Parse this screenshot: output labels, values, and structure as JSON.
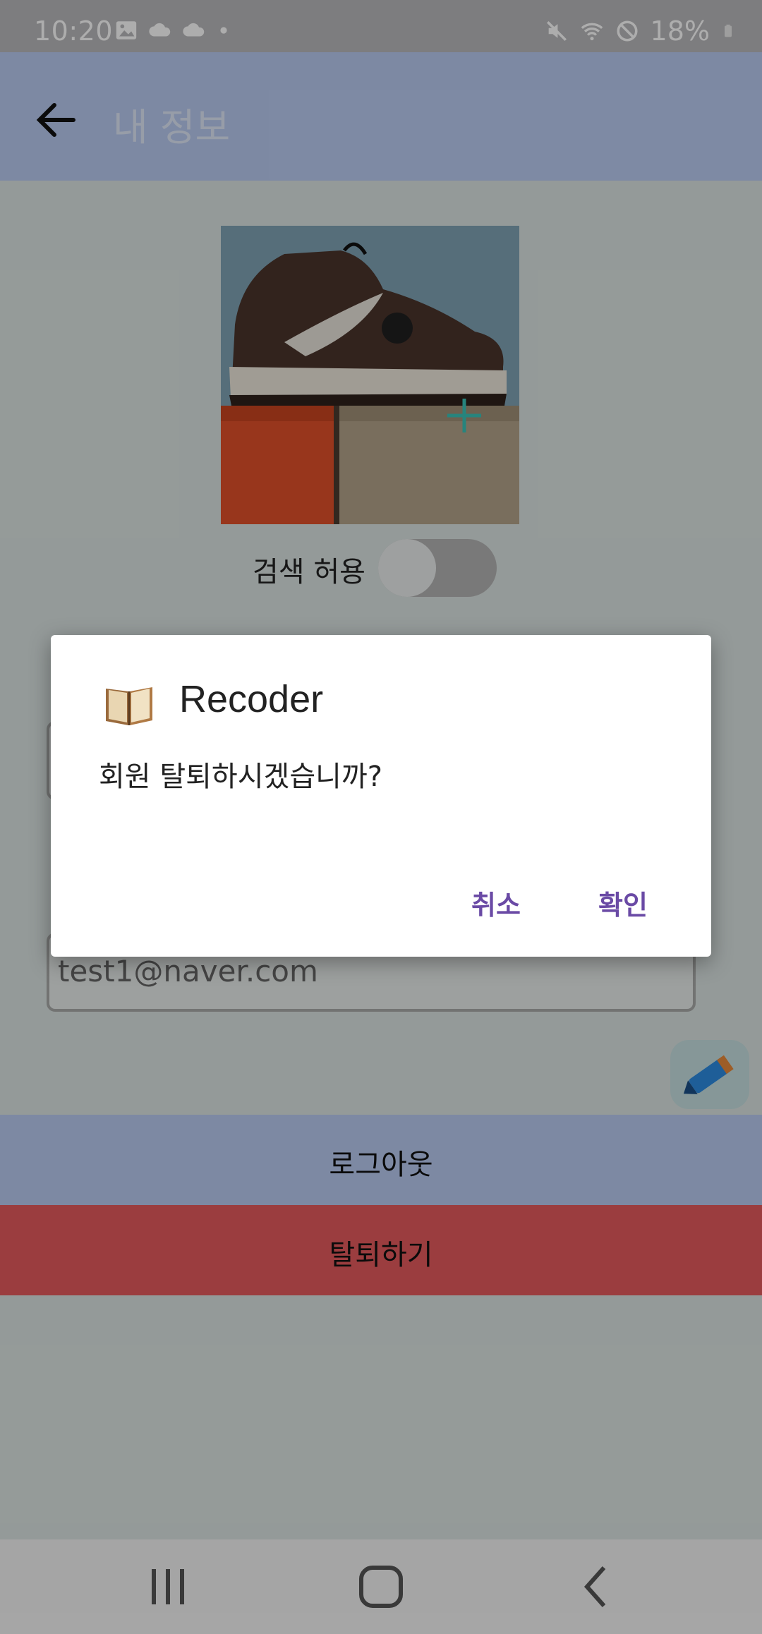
{
  "status_bar": {
    "time": "10:20",
    "battery": "18%",
    "left_icons": [
      "gallery-icon",
      "cloud-icon",
      "cloud-icon",
      "dot-icon"
    ],
    "right_icons": [
      "mute-icon",
      "wifi-icon",
      "block-icon",
      "battery-icon"
    ]
  },
  "app_bar": {
    "title": "내 정보",
    "back_icon": "arrow-left-icon",
    "background": "#b9cbf1"
  },
  "profile": {
    "search_label": "검색 허용",
    "search_toggle_on": false
  },
  "fields": [
    {
      "label": "",
      "value": ""
    },
    {
      "label": "",
      "value": "test1@naver.com"
    }
  ],
  "actions": {
    "logout_label": "로그아웃",
    "delete_label": "탈퇴하기",
    "delete_color": "#e55a5d"
  },
  "dialog": {
    "title": "Recoder",
    "message": "회원 탈퇴하시겠습니까?",
    "cancel_label": "취소",
    "confirm_label": "확인",
    "accent": "#6a4aa5"
  },
  "nav_bar": {
    "icons": [
      "recent-apps-icon",
      "home-icon",
      "back-icon"
    ]
  }
}
